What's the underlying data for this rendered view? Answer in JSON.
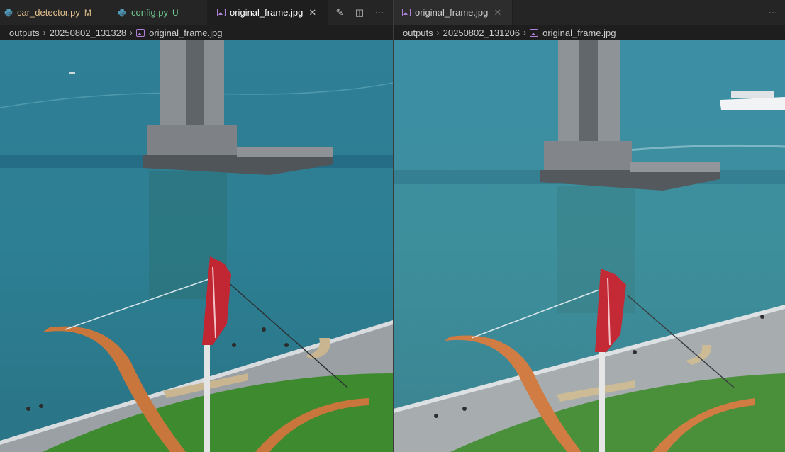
{
  "left_group": {
    "tabs": [
      {
        "label": "car_detector.py",
        "badge": "M",
        "icon": "python-file-icon"
      },
      {
        "label": "config.py",
        "badge": "U",
        "icon": "python-file-icon"
      },
      {
        "label": "original_frame.jpg",
        "icon": "image-file-icon",
        "active": true
      }
    ],
    "actions": [
      "open-changes-icon",
      "split-editor-icon",
      "more-actions-icon"
    ],
    "action_glyphs": {
      "edit": "✎",
      "split": "◫",
      "more": "···"
    },
    "close_glyph": "✕",
    "breadcrumb": [
      "outputs",
      "20250802_131328",
      "original_frame.jpg"
    ]
  },
  "right_group": {
    "tabs": [
      {
        "label": "original_frame.jpg",
        "icon": "image-file-icon",
        "active": false
      }
    ],
    "actions": [
      "more-actions-icon"
    ],
    "action_glyphs": {
      "more": "···"
    },
    "close_glyph": "✕",
    "breadcrumb": [
      "outputs",
      "20250802_131206",
      "original_frame.jpg"
    ]
  },
  "breadcrumb_separator": "›",
  "colors": {
    "modified": "#e2c08d",
    "untracked": "#73c991",
    "python_icon": "#519aba",
    "image_icon": "#b180d7",
    "water": "#2d7f95",
    "grass": "#3e8a2e",
    "bow": "#c9763d",
    "arrow_feather": "#c02733"
  }
}
